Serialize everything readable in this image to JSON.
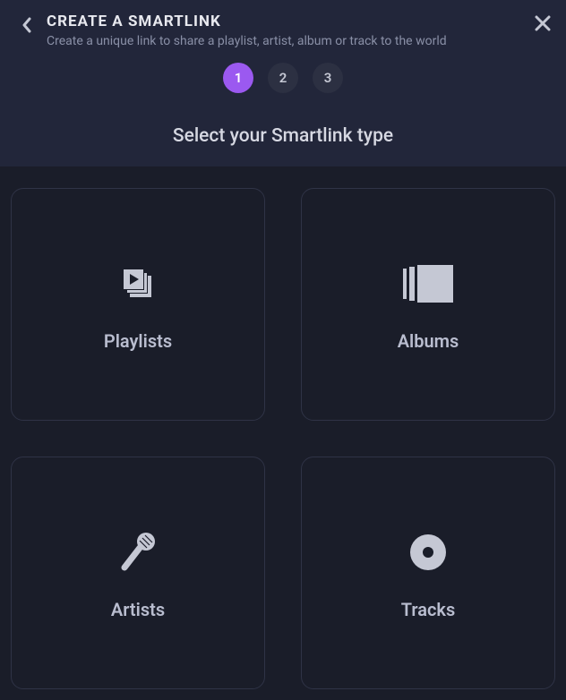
{
  "header": {
    "title": "CREATE A SMARTLINK",
    "subtitle": "Create a unique link to share a playlist, artist, album or track to the world"
  },
  "steps": {
    "items": [
      "1",
      "2",
      "3"
    ],
    "activeIndex": 0
  },
  "sectionTitle": "Select your Smartlink type",
  "cards": [
    {
      "label": "Playlists",
      "icon": "playlist-icon"
    },
    {
      "label": "Albums",
      "icon": "album-icon"
    },
    {
      "label": "Artists",
      "icon": "microphone-icon"
    },
    {
      "label": "Tracks",
      "icon": "disc-icon"
    }
  ]
}
